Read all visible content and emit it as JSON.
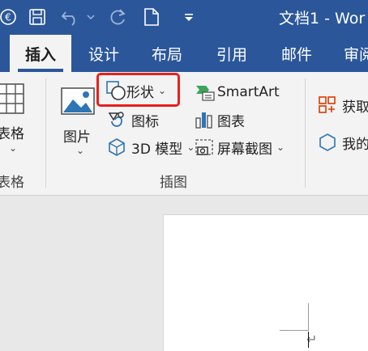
{
  "titlebar": {
    "title": "文档1 - Wor",
    "autosave_icon": "coin-icon",
    "save_icon": "save-icon",
    "undo_icon": "undo-icon",
    "redo_icon": "redo-icon",
    "new_icon": "new-document-icon",
    "customize_icon": "dropdown-icon",
    "colors": {
      "background": "#2b579a",
      "text": "#ffffff"
    }
  },
  "tabs": [
    {
      "label": "插入",
      "active": true
    },
    {
      "label": "设计",
      "active": false
    },
    {
      "label": "布局",
      "active": false
    },
    {
      "label": "引用",
      "active": false
    },
    {
      "label": "邮件",
      "active": false
    },
    {
      "label": "审阅",
      "active": false
    }
  ],
  "ribbon": {
    "tables": {
      "button_label": "表格",
      "group_label": "表格"
    },
    "illustrations": {
      "group_label": "插图",
      "picture": "图片",
      "shapes": "形状",
      "icons": "图标",
      "models3d": "3D 模型",
      "smartart": "SmartArt",
      "chart": "图表",
      "screenshot": "屏幕截图"
    },
    "addins": {
      "get": "获取",
      "my": "我的"
    },
    "highlight_color": "#e8201c"
  },
  "document": {
    "paragraph_mark": "↵"
  }
}
